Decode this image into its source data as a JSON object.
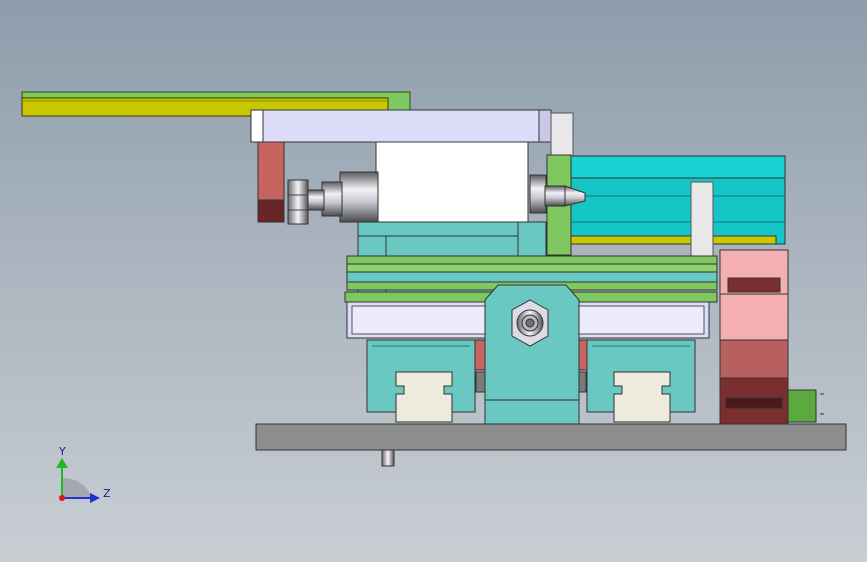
{
  "viewport": {
    "background_top": "#8e9cab",
    "background_bottom": "#c8ced3"
  },
  "triad": {
    "y_label": "Y",
    "z_label": "Z",
    "y_color": "#23b823",
    "z_color": "#2330d0",
    "x_color": "#d01c1c"
  },
  "colors": {
    "yellow_bar": "#c8c800",
    "green_part": "#7fc860",
    "cylinder_body": "#dcdcf8",
    "red_handle": "#c8645f",
    "dark_red": "#6a2626",
    "motor_white": "#ffffff",
    "teal": "#6ac8c2",
    "cyan_actuator": "#16c6c6",
    "base_plate": "#8e8e8e",
    "pink_chain": "#f4b0b0",
    "chain_dark": "#7a2e2e"
  }
}
